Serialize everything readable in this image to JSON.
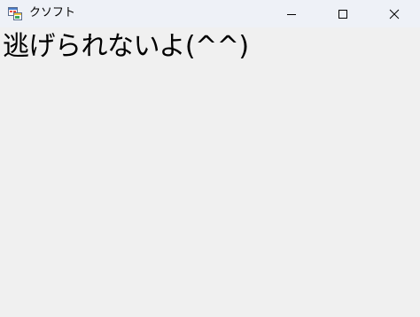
{
  "window": {
    "title": "クソフト",
    "icon": "application-form-icon"
  },
  "caption_buttons": {
    "minimize": "minimize-icon",
    "maximize": "maximize-icon",
    "close": "close-icon"
  },
  "content": {
    "label": "逃げられないよ(^^)"
  }
}
